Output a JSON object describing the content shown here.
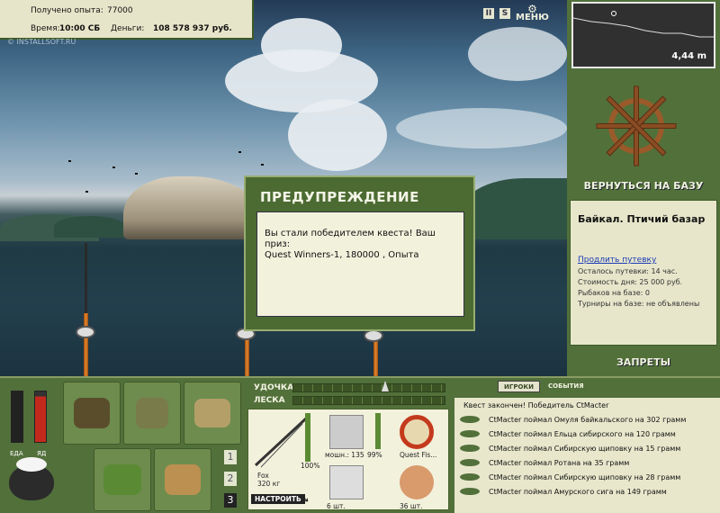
{
  "top_info": {
    "experience_label": "Получено опыта:",
    "experience_value": "77000",
    "time_label": "Время:",
    "time_value": "10:00 СБ",
    "money_label": "Деньги:",
    "money_value": "108 578 937 руб.",
    "watermark": "© INSTALLSOFT.RU"
  },
  "top_icons": {
    "pause": "II",
    "sound": "S",
    "menu_label": "МЕНЮ"
  },
  "depth": {
    "value": "4,44 m"
  },
  "right_panel": {
    "return_label": "ВЕРНУТЬСЯ НА БАЗУ",
    "location_name": "Байкал. Птичий базар",
    "extend_link": "Продлить путевку",
    "lines": [
      "Осталось путевки: 14 час.",
      "Стоимость дня: 25 000 руб.",
      "Рыбаков на базе: 0",
      "Турниры на базе: не объявлены"
    ],
    "bans_label": "ЗАПРЕТЫ"
  },
  "dialog": {
    "title": "ПРЕДУПРЕЖДЕНИЕ",
    "message_line1": "Вы стали победителем квеста! Ваш приз:",
    "message_line2": "Quest Winners-1, 180000 , Опыта"
  },
  "meters": {
    "food_label": "ЕДА",
    "poison_label": "ЯД",
    "food_level": 0.0,
    "poison_level": 0.9
  },
  "slot_numbers": [
    "1",
    "2",
    "3"
  ],
  "gauges": {
    "rod_label": "УДОЧКА",
    "line_label": "ЛЕСКА"
  },
  "tackle": {
    "rod_percent": "100%",
    "rod_name": "Fox",
    "rod_weight": "320 кг",
    "setup_button": "НАСТРОИТЬ",
    "reel_label": "мошн.: 135",
    "reel_percent": "99%",
    "line_label": "Quest Fis...",
    "hook_count": "6 шт.",
    "bait_count": "36 шт."
  },
  "events": {
    "tab_players": "ИГРОКИ",
    "tab_events": "СОБЫТИЯ",
    "header": "Квест закончен! Победитель CtMacter",
    "rows": [
      "CtMacter поймал Омуля байкальского на 302 грамм",
      "CtMacter поймал Ельца сибирского на 120 грамм",
      "CtMacter поймал Сибирскую щиповку на 15 грамм",
      "CtMacter поймал Ротана на 35 грамм",
      "CtMacter поймал Сибирскую щиповку на 28 грамм",
      "CtMacter поймал Амурского сига на 149 грамм"
    ]
  },
  "colors": {
    "panel_green": "#52703a",
    "paper": "#e7e5c9",
    "rod_orange": "#e08a2c",
    "poison_red": "#c42a1c"
  }
}
